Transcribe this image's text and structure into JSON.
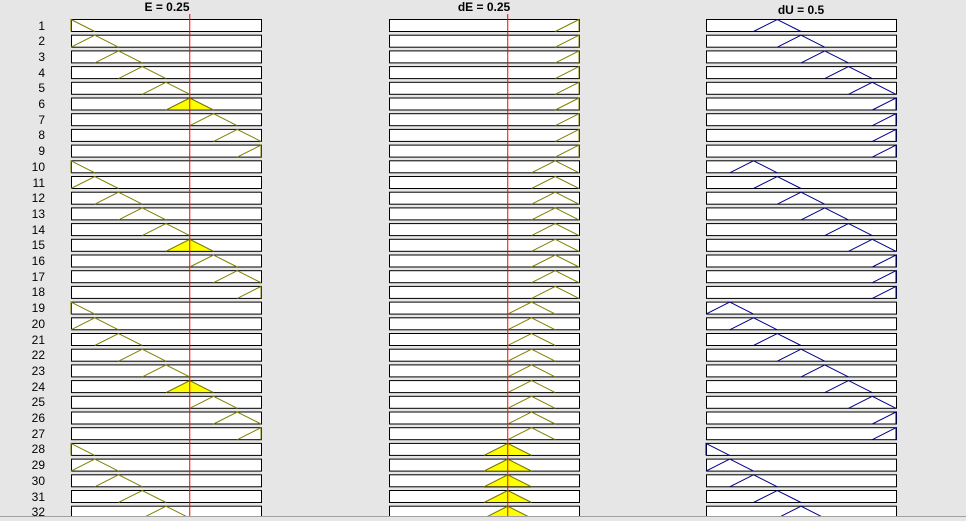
{
  "columns": [
    {
      "title": "E = 0.25",
      "kind": "input",
      "line_color": "#808000",
      "value": 0.25
    },
    {
      "title": "dE = 0.25",
      "kind": "input",
      "line_color": "#808000",
      "value": 0.25
    },
    {
      "title": "dU = 0.5",
      "kind": "output",
      "line_color": "#00008b",
      "value": 0.5
    }
  ],
  "indicator_color": "#ff0000",
  "fill_color": "#ffff00",
  "rules": [
    {
      "label": "1",
      "e": 0,
      "de": 8,
      "du": 3,
      "fire": [
        false,
        false,
        false
      ]
    },
    {
      "label": "2",
      "e": 1,
      "de": 8,
      "du": 4,
      "fire": [
        false,
        false,
        false
      ]
    },
    {
      "label": "3",
      "e": 2,
      "de": 8,
      "du": 5,
      "fire": [
        false,
        false,
        false
      ]
    },
    {
      "label": "4",
      "e": 3,
      "de": 8,
      "du": 6,
      "fire": [
        false,
        false,
        false
      ]
    },
    {
      "label": "5",
      "e": 4,
      "de": 8,
      "du": 7,
      "fire": [
        false,
        false,
        false
      ]
    },
    {
      "label": "6",
      "e": 5,
      "de": 8,
      "du": 8,
      "fire": [
        true,
        false,
        false
      ]
    },
    {
      "label": "7",
      "e": 6,
      "de": 8,
      "du": 8,
      "fire": [
        false,
        false,
        false
      ]
    },
    {
      "label": "8",
      "e": 7,
      "de": 8,
      "du": 8,
      "fire": [
        false,
        false,
        false
      ]
    },
    {
      "label": "9",
      "e": 8,
      "de": 8,
      "du": 8,
      "fire": [
        false,
        false,
        false
      ]
    },
    {
      "label": "10",
      "e": 0,
      "de": 7,
      "du": 2,
      "fire": [
        false,
        false,
        false
      ]
    },
    {
      "label": "11",
      "e": 1,
      "de": 7,
      "du": 3,
      "fire": [
        false,
        false,
        false
      ]
    },
    {
      "label": "12",
      "e": 2,
      "de": 7,
      "du": 4,
      "fire": [
        false,
        false,
        false
      ]
    },
    {
      "label": "13",
      "e": 3,
      "de": 7,
      "du": 5,
      "fire": [
        false,
        false,
        false
      ]
    },
    {
      "label": "14",
      "e": 4,
      "de": 7,
      "du": 6,
      "fire": [
        false,
        false,
        false
      ]
    },
    {
      "label": "15",
      "e": 5,
      "de": 7,
      "du": 7,
      "fire": [
        true,
        false,
        false
      ]
    },
    {
      "label": "16",
      "e": 6,
      "de": 7,
      "du": 8,
      "fire": [
        false,
        false,
        false
      ]
    },
    {
      "label": "17",
      "e": 7,
      "de": 7,
      "du": 8,
      "fire": [
        false,
        false,
        false
      ]
    },
    {
      "label": "18",
      "e": 8,
      "de": 7,
      "du": 8,
      "fire": [
        false,
        false,
        false
      ]
    },
    {
      "label": "19",
      "e": 0,
      "de": 6,
      "du": 1,
      "fire": [
        false,
        false,
        false
      ]
    },
    {
      "label": "20",
      "e": 1,
      "de": 6,
      "du": 2,
      "fire": [
        false,
        false,
        false
      ]
    },
    {
      "label": "21",
      "e": 2,
      "de": 6,
      "du": 3,
      "fire": [
        false,
        false,
        false
      ]
    },
    {
      "label": "22",
      "e": 3,
      "de": 6,
      "du": 4,
      "fire": [
        false,
        false,
        false
      ]
    },
    {
      "label": "23",
      "e": 4,
      "de": 6,
      "du": 5,
      "fire": [
        false,
        false,
        false
      ]
    },
    {
      "label": "24",
      "e": 5,
      "de": 6,
      "du": 6,
      "fire": [
        true,
        false,
        false
      ]
    },
    {
      "label": "25",
      "e": 6,
      "de": 6,
      "du": 7,
      "fire": [
        false,
        false,
        false
      ]
    },
    {
      "label": "26",
      "e": 7,
      "de": 6,
      "du": 8,
      "fire": [
        false,
        false,
        false
      ]
    },
    {
      "label": "27",
      "e": 8,
      "de": 6,
      "du": 8,
      "fire": [
        false,
        false,
        false
      ]
    },
    {
      "label": "28",
      "e": 0,
      "de": 5,
      "du": 0,
      "fire": [
        false,
        true,
        false
      ]
    },
    {
      "label": "29",
      "e": 1,
      "de": 5,
      "du": 1,
      "fire": [
        false,
        true,
        false
      ]
    },
    {
      "label": "30",
      "e": 2,
      "de": 5,
      "du": 2,
      "fire": [
        false,
        true,
        false
      ]
    },
    {
      "label": "31",
      "e": 3,
      "de": 5,
      "du": 3,
      "fire": [
        false,
        true,
        false
      ]
    },
    {
      "label": "32",
      "e": 4,
      "de": 5,
      "du": 4,
      "fire": [
        false,
        true,
        false
      ]
    }
  ]
}
